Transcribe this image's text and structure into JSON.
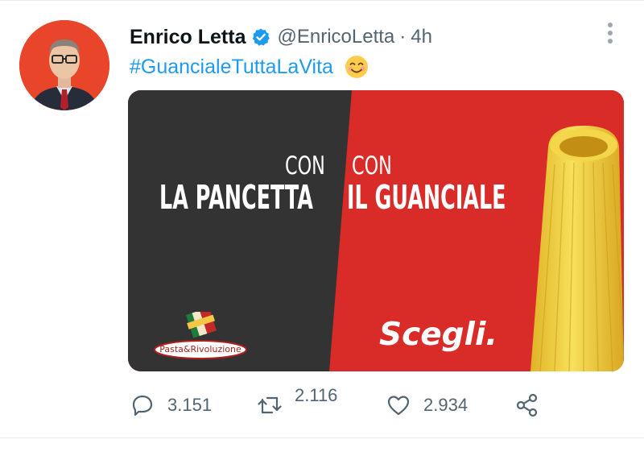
{
  "tweet": {
    "author_name": "Enrico Letta",
    "handle": "@EnricoLetta",
    "separator": "·",
    "timestamp": "4h",
    "hashtag": "#GuancialeTuttaLaVita"
  },
  "media": {
    "con_left": "CON",
    "con_right": "CON",
    "line_left": "LA PANCETTA",
    "line_right": "IL GUANCIALE",
    "cta": "Scegli.",
    "brand": "Pasta&Rivoluzione"
  },
  "actions": {
    "reply_count": "3.151",
    "retweet_count": "2.116",
    "like_count": "2.934"
  },
  "icons": {
    "verified": "verified-badge-icon",
    "emoji": "smiling-face-icon",
    "more": "more-vertical-icon",
    "reply": "reply-icon",
    "retweet": "retweet-icon",
    "like": "heart-icon",
    "share": "share-icon"
  },
  "colors": {
    "link": "#1d9bf0",
    "muted": "#536471",
    "ad_dark": "#333333",
    "ad_red": "#d92b27"
  }
}
